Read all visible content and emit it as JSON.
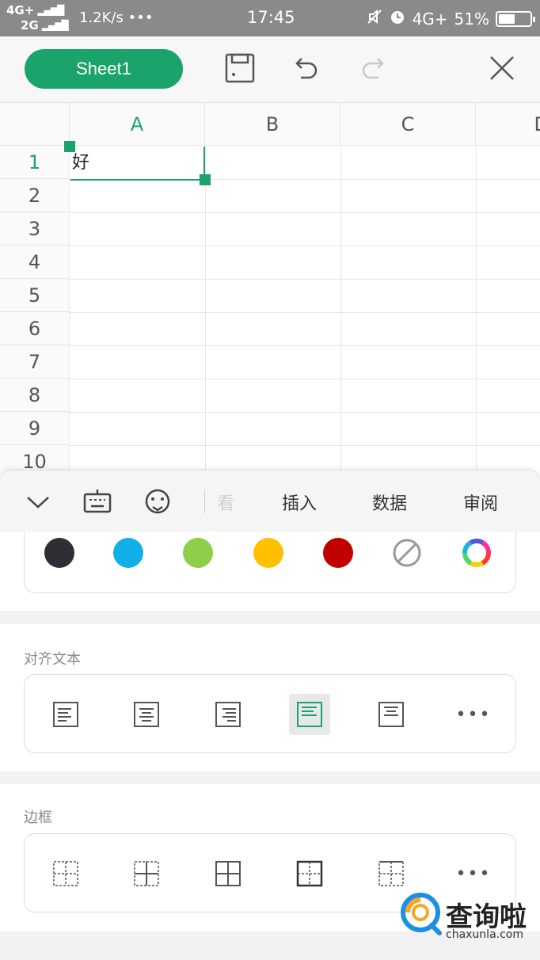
{
  "status_bar": {
    "network_top": "4G+",
    "network_bottom": "2G",
    "speed": "1.2K/s",
    "dots": "•••",
    "time": "17:45",
    "network_right": "4G+",
    "battery": "51%"
  },
  "toolbar": {
    "sheet_tab": "Sheet1",
    "icons": [
      "save-icon",
      "undo-icon",
      "redo-icon",
      "close-icon"
    ],
    "accent": "#1aa36b"
  },
  "grid": {
    "columns": [
      "A",
      "B",
      "C",
      "D"
    ],
    "rows": [
      "1",
      "2",
      "3",
      "4",
      "5",
      "6",
      "7",
      "8",
      "9",
      "10"
    ],
    "cell_a1": "好",
    "selected_row": "1",
    "selected_column": "A"
  },
  "bottom_tabs": {
    "icons": [
      "chevron-down-icon",
      "keyboard-icon",
      "emoji-icon"
    ],
    "partial_label": "看",
    "items": [
      "插入",
      "数据",
      "审阅"
    ]
  },
  "colors": {
    "swatches": [
      "#2e2e34",
      "#11aee8",
      "#8ecf4a",
      "#ffc000",
      "#c10000"
    ],
    "extra_icons": [
      "no-color-icon",
      "color-wheel-icon"
    ]
  },
  "align_section": {
    "title": "对齐文本",
    "icons": [
      "align-left-icon",
      "align-center-icon",
      "align-right-icon",
      "align-top-left-icon",
      "align-top-center-icon",
      "more-icon"
    ],
    "more": "•••"
  },
  "border_section": {
    "title": "边框",
    "icons": [
      "border-none-icon",
      "border-inner-icon",
      "border-all-icon",
      "border-outer-icon",
      "border-dashed-icon",
      "more-icon"
    ],
    "more": "•••"
  },
  "watermark": {
    "text": "查询啦",
    "url": "chaxunla.com"
  }
}
